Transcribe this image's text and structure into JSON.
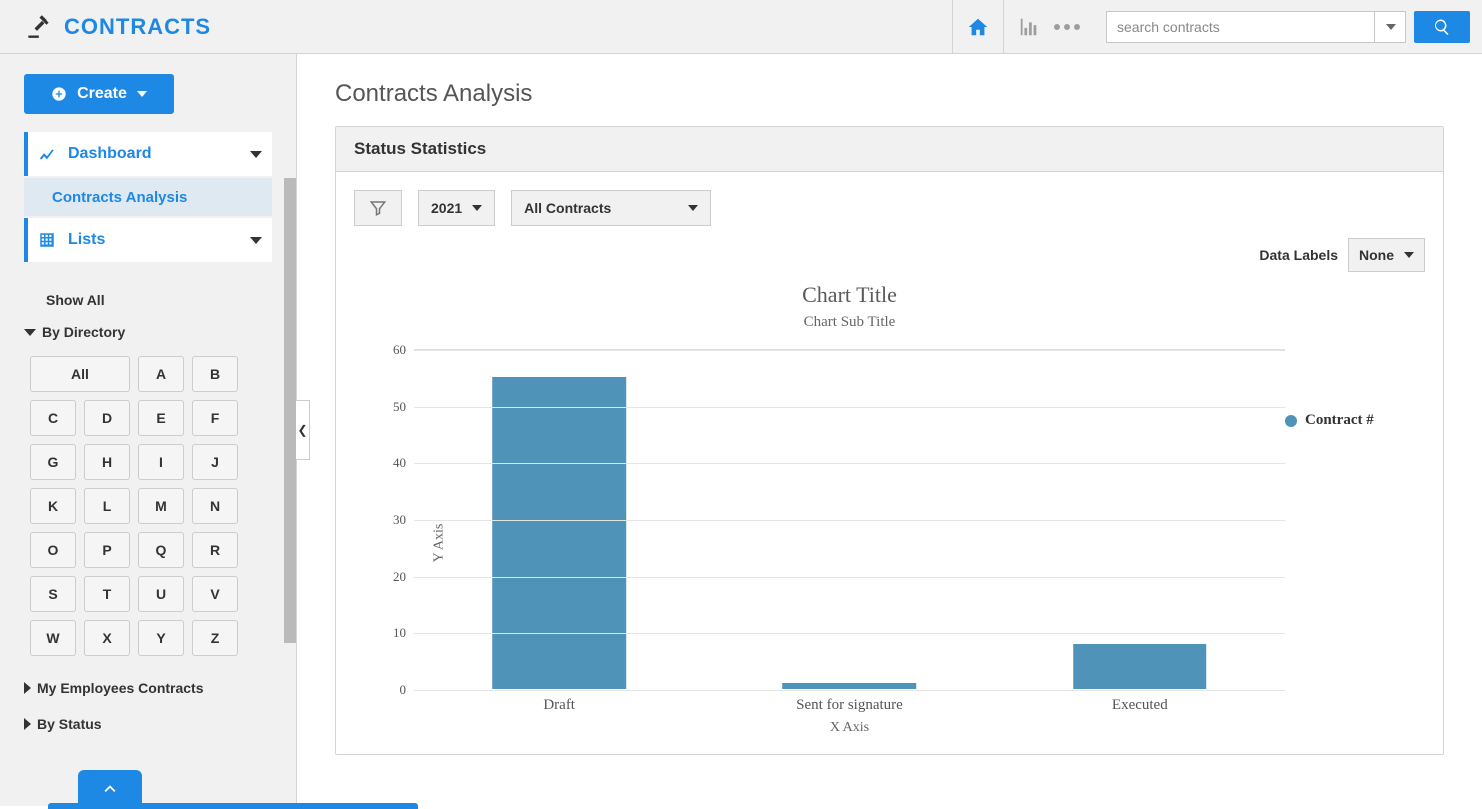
{
  "brand": {
    "title": "CONTRACTS"
  },
  "topbar": {
    "search_placeholder": "search contracts"
  },
  "sidebar": {
    "create_label": "Create",
    "nav": {
      "dashboard": "Dashboard",
      "contracts_analysis": "Contracts Analysis",
      "lists": "Lists"
    },
    "show_all": "Show All",
    "by_directory": "By Directory",
    "alpha": [
      "All",
      "A",
      "B",
      "C",
      "D",
      "E",
      "F",
      "G",
      "H",
      "I",
      "J",
      "K",
      "L",
      "M",
      "N",
      "O",
      "P",
      "Q",
      "R",
      "S",
      "T",
      "U",
      "V",
      "W",
      "X",
      "Y",
      "Z"
    ],
    "my_employees_contracts": "My Employees Contracts",
    "by_status": "By Status"
  },
  "page": {
    "title": "Contracts Analysis"
  },
  "panel": {
    "title": "Status Statistics",
    "controls": {
      "year": "2021",
      "scope": "All Contracts"
    },
    "data_labels": {
      "label": "Data Labels",
      "value": "None"
    }
  },
  "chart_data": {
    "type": "bar",
    "title": "Chart Title",
    "subtitle": "Chart Sub Title",
    "xlabel": "X Axis",
    "ylabel": "Y Axis",
    "ylim": [
      0,
      60
    ],
    "y_ticks": [
      0,
      10,
      20,
      30,
      40,
      50,
      60
    ],
    "categories": [
      "Draft",
      "Sent for signature",
      "Executed"
    ],
    "series": [
      {
        "name": "Contract #",
        "values": [
          55,
          1,
          8
        ],
        "color": "#4f93b8"
      }
    ]
  }
}
